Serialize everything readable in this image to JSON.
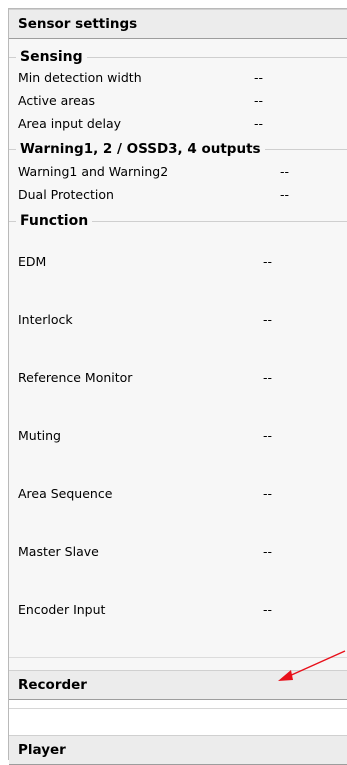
{
  "header": {
    "title": "Sensor settings"
  },
  "sensing": {
    "title": "Sensing",
    "rows": [
      {
        "label": "Min detection width",
        "value": "--"
      },
      {
        "label": "Active areas",
        "value": "--"
      },
      {
        "label": "Area input delay",
        "value": "--"
      }
    ]
  },
  "outputs": {
    "title": "Warning1, 2 / OSSD3, 4 outputs",
    "rows": [
      {
        "label": "Warning1 and Warning2",
        "value": "--"
      },
      {
        "label": "Dual Protection",
        "value": "--"
      }
    ]
  },
  "function": {
    "title": "Function",
    "rows": [
      {
        "label": "EDM",
        "value": "--"
      },
      {
        "label": "Interlock",
        "value": "--"
      },
      {
        "label": "Reference Monitor",
        "value": "--"
      },
      {
        "label": "Muting",
        "value": "--"
      },
      {
        "label": "Area Sequence",
        "value": "--"
      },
      {
        "label": "Master Slave",
        "value": "--"
      },
      {
        "label": "Encoder Input",
        "value": "--"
      }
    ]
  },
  "sections": {
    "recorder": "Recorder",
    "player": "Player"
  },
  "colors": {
    "annotation_arrow": "#e8101a"
  }
}
